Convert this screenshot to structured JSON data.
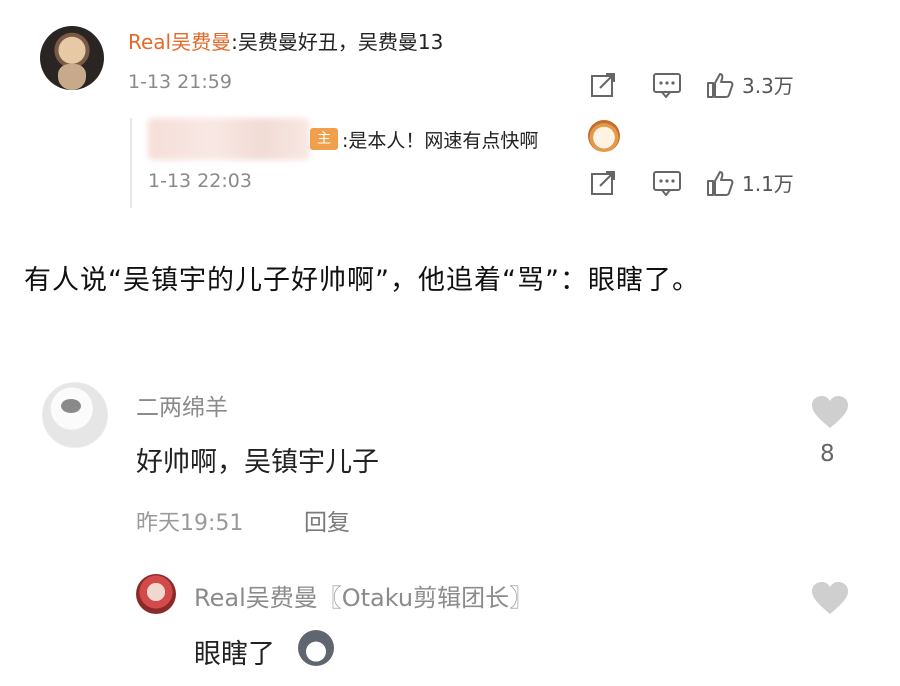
{
  "top_comment": {
    "username": "Real吴费曼",
    "text": ":吴费曼好丑，吴费曼13",
    "time": "1-13 21:59",
    "like_count": "3.3万"
  },
  "nested_reply": {
    "badge": "主",
    "text": ":是本人！网速有点快啊",
    "time": "1-13 22:03",
    "like_count": "1.1万"
  },
  "caption": "有人说“吴镇宇的儿子好帅啊”，他追着“骂”：眼瞎了。",
  "comment2": {
    "username": "二两绵羊",
    "text": "好帅啊，吴镇宇儿子",
    "time": "昨天19:51",
    "reply_label": "回复",
    "like_count": "8"
  },
  "comment3": {
    "username": "Real吴费曼〖Otaku剪辑团长〗",
    "text": "眼瞎了"
  },
  "icons": {
    "share": "share-icon",
    "comment": "comment-icon",
    "like": "thumbs-up-icon",
    "heart": "heart-icon",
    "emoji_cat": "cat-emoji-icon",
    "emoji_husky": "husky-emoji-icon"
  }
}
